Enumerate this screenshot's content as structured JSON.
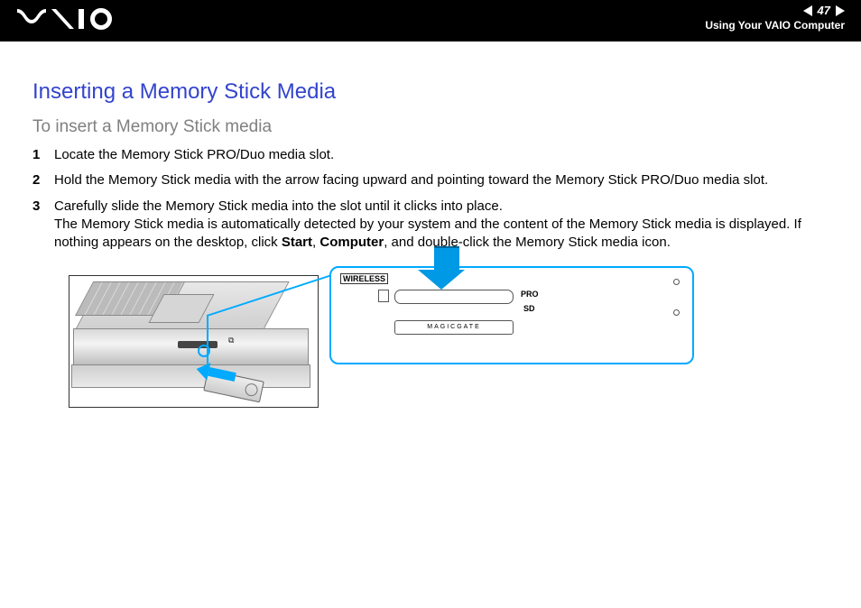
{
  "header": {
    "page_number": "47",
    "section": "Using Your VAIO Computer",
    "brand": "VAIO"
  },
  "title": "Inserting a Memory Stick Media",
  "subtitle": "To insert a Memory Stick media",
  "steps": {
    "s1": "Locate the Memory Stick PRO/Duo media slot.",
    "s2": "Hold the Memory Stick media with the arrow facing upward and pointing toward the Memory Stick PRO/Duo media slot.",
    "s3a": "Carefully slide the Memory Stick media into the slot until it clicks into place.",
    "s3b_pre": "The Memory Stick media is automatically detected by your system and the content of the Memory Stick media is displayed. If nothing appears on the desktop, click ",
    "s3b_bold1": "Start",
    "s3b_mid": ", ",
    "s3b_bold2": "Computer",
    "s3b_post": ", and double-click the Memory Stick media icon."
  },
  "figure": {
    "wireless": "WIRELESS",
    "pro": "PRO",
    "sd": "SD",
    "magicgate": "MAGICGATE"
  }
}
